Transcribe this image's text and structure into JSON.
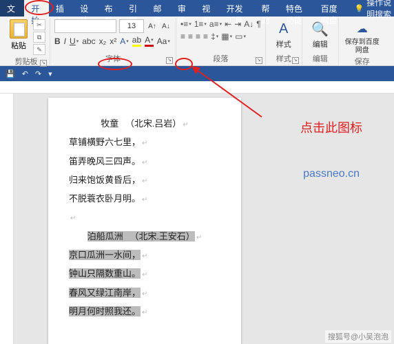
{
  "menu": {
    "file": "文件",
    "home": "开始",
    "insert": "插入",
    "design": "设计",
    "layout": "布局",
    "references": "引用",
    "mailings": "邮件",
    "review": "审阅",
    "view": "视图",
    "devtools": "开发工具",
    "help": "帮助",
    "special": "特色功能",
    "baidu": "百度网盘",
    "tellme": "操作说明搜索"
  },
  "ribbon": {
    "clipboard": {
      "paste": "粘贴",
      "label": "剪贴板"
    },
    "font": {
      "size": "13",
      "label": "字体"
    },
    "paragraph": {
      "label": "段落"
    },
    "styles": {
      "label": "样式"
    },
    "editing": {
      "label": "编辑"
    },
    "save": {
      "btn": "保存到百度网盘",
      "label": "保存"
    }
  },
  "poem1": {
    "title_a": "牧童",
    "title_b": "（北宋.吕岩）",
    "l1": "草铺横野六七里，",
    "l2": "笛弄晚风三四声。",
    "l3": "归来饱饭黄昏后，",
    "l4": "不脱蓑衣卧月明。"
  },
  "poem2": {
    "title_a": "泊船瓜洲",
    "title_b": "（北宋.王安石）",
    "l1": "京口瓜洲一水间，",
    "l2": "钟山只隔数重山。",
    "l3": "春风又绿江南岸，",
    "l4": "明月何时照我还。"
  },
  "callout": "点击此图标",
  "watermark": "passneo.cn",
  "credit": "搜狐号@小吴泡泡"
}
